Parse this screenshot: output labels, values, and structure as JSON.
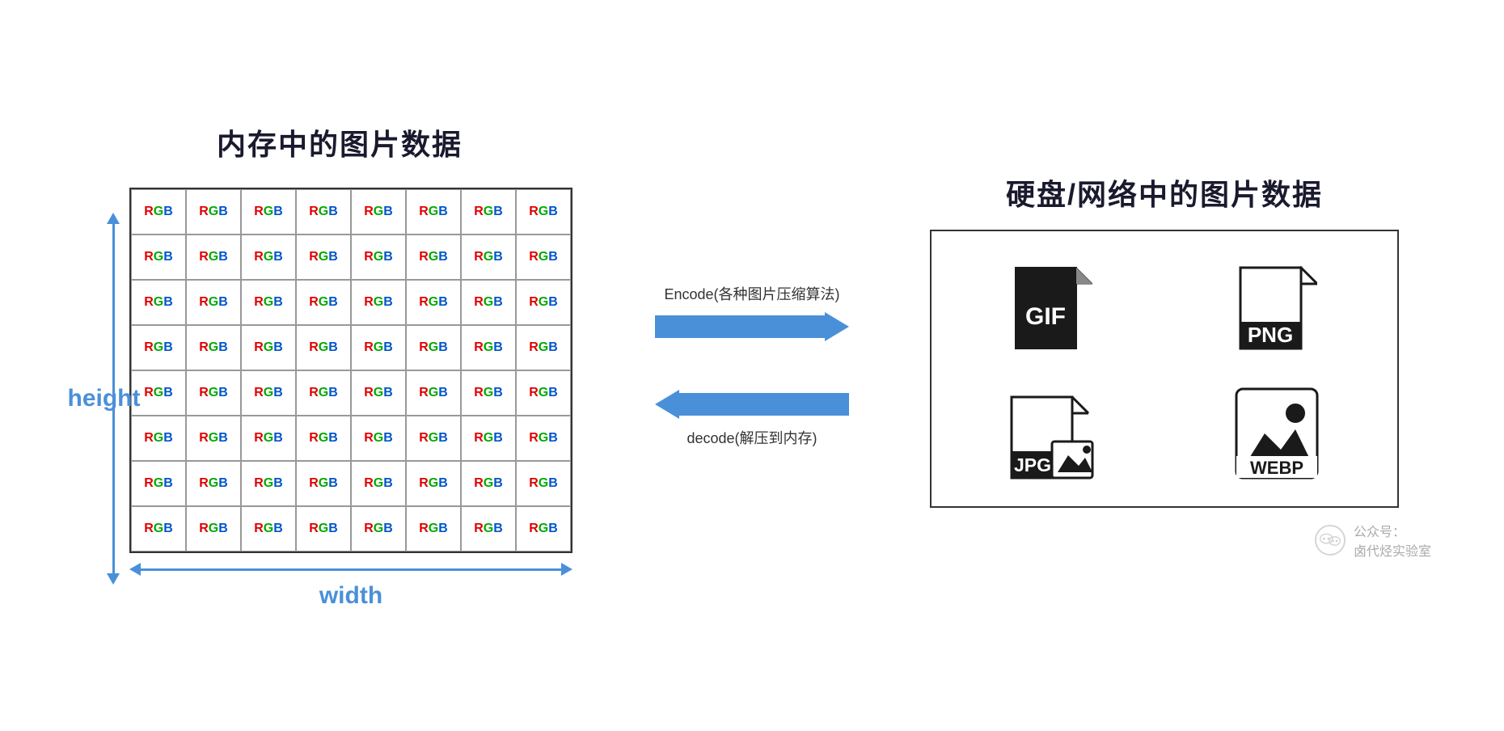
{
  "left": {
    "title": "内存中的图片数据",
    "height_label": "height",
    "width_label": "width",
    "grid": {
      "rows": 8,
      "cols": 8,
      "cell_text": "RGB"
    }
  },
  "middle": {
    "encode_label": "Encode(各种图片压缩算法)",
    "decode_label": "decode(解压到内存)"
  },
  "right": {
    "title": "硬盘/网络中的图片数据",
    "formats": [
      "GIF",
      "PNG",
      "JPG",
      "WEBP"
    ]
  },
  "watermark": {
    "line1": "公众号：",
    "line2": "卤代烃实验室"
  }
}
